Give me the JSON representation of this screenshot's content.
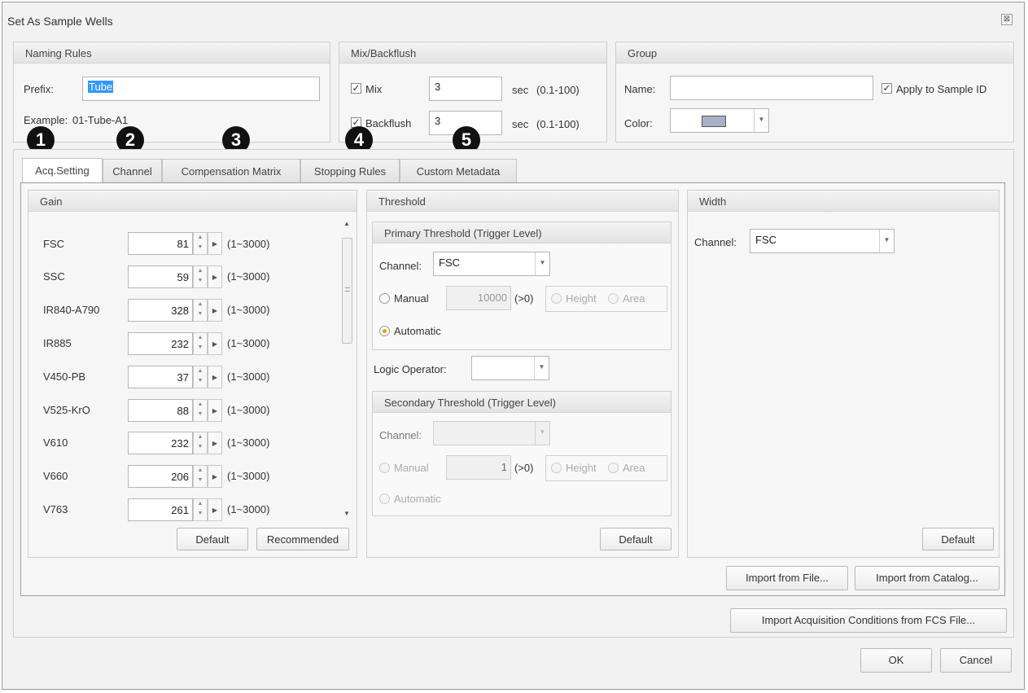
{
  "title": "Set As Sample Wells",
  "close_glyph": "⊠",
  "naming": {
    "header": "Naming Rules",
    "prefix_label": "Prefix:",
    "prefix_value": "Tube",
    "example_label": "Example:",
    "example_value": "01-Tube-A1"
  },
  "mix": {
    "header": "Mix/Backflush",
    "mix_label": "Mix",
    "mix_value": "3",
    "mix_unit": "sec",
    "mix_range": "(0.1-100)",
    "backflush_label": "Backflush",
    "backflush_value": "3",
    "backflush_unit": "sec",
    "backflush_range": "(0.1-100)"
  },
  "group": {
    "header": "Group",
    "name_label": "Name:",
    "name_value": "",
    "apply_label": "Apply to Sample ID",
    "color_label": "Color:",
    "color_swatch": "#a8b0c8"
  },
  "badges": [
    "1",
    "2",
    "3",
    "4",
    "5"
  ],
  "tabs": [
    "Acq.Setting",
    "Channel",
    "Compensation Matrix",
    "Stopping Rules",
    "Custom Metadata"
  ],
  "gain": {
    "header": "Gain",
    "rows": [
      {
        "label": "FSC",
        "value": "81",
        "range": "(1~3000)"
      },
      {
        "label": "SSC",
        "value": "59",
        "range": "(1~3000)"
      },
      {
        "label": "IR840-A790",
        "value": "328",
        "range": "(1~3000)"
      },
      {
        "label": "IR885",
        "value": "232",
        "range": "(1~3000)"
      },
      {
        "label": "V450-PB",
        "value": "37",
        "range": "(1~3000)"
      },
      {
        "label": "V525-KrO",
        "value": "88",
        "range": "(1~3000)"
      },
      {
        "label": "V610",
        "value": "232",
        "range": "(1~3000)"
      },
      {
        "label": "V660",
        "value": "206",
        "range": "(1~3000)"
      },
      {
        "label": "V763",
        "value": "261",
        "range": "(1~3000)"
      }
    ],
    "default_label": "Default",
    "recommended_label": "Recommended"
  },
  "threshold": {
    "header": "Threshold",
    "primary_header": "Primary Threshold (Trigger Level)",
    "channel_label": "Channel:",
    "primary_channel": "FSC",
    "manual_label": "Manual",
    "primary_manual_value": "10000",
    "gt_zero": "(>0)",
    "height_label": "Height",
    "area_label": "Area",
    "automatic_label": "Automatic",
    "logic_label": "Logic Operator:",
    "logic_value": "",
    "secondary_header": "Secondary Threshold (Trigger Level)",
    "secondary_channel": "",
    "secondary_manual_value": "1",
    "default_label": "Default"
  },
  "width": {
    "header": "Width",
    "channel_label": "Channel:",
    "channel_value": "FSC",
    "default_label": "Default"
  },
  "import_file_label": "Import from File...",
  "import_catalog_label": "Import from Catalog...",
  "import_fcs_label": "Import Acquisition Conditions from FCS File...",
  "ok_label": "OK",
  "cancel_label": "Cancel"
}
